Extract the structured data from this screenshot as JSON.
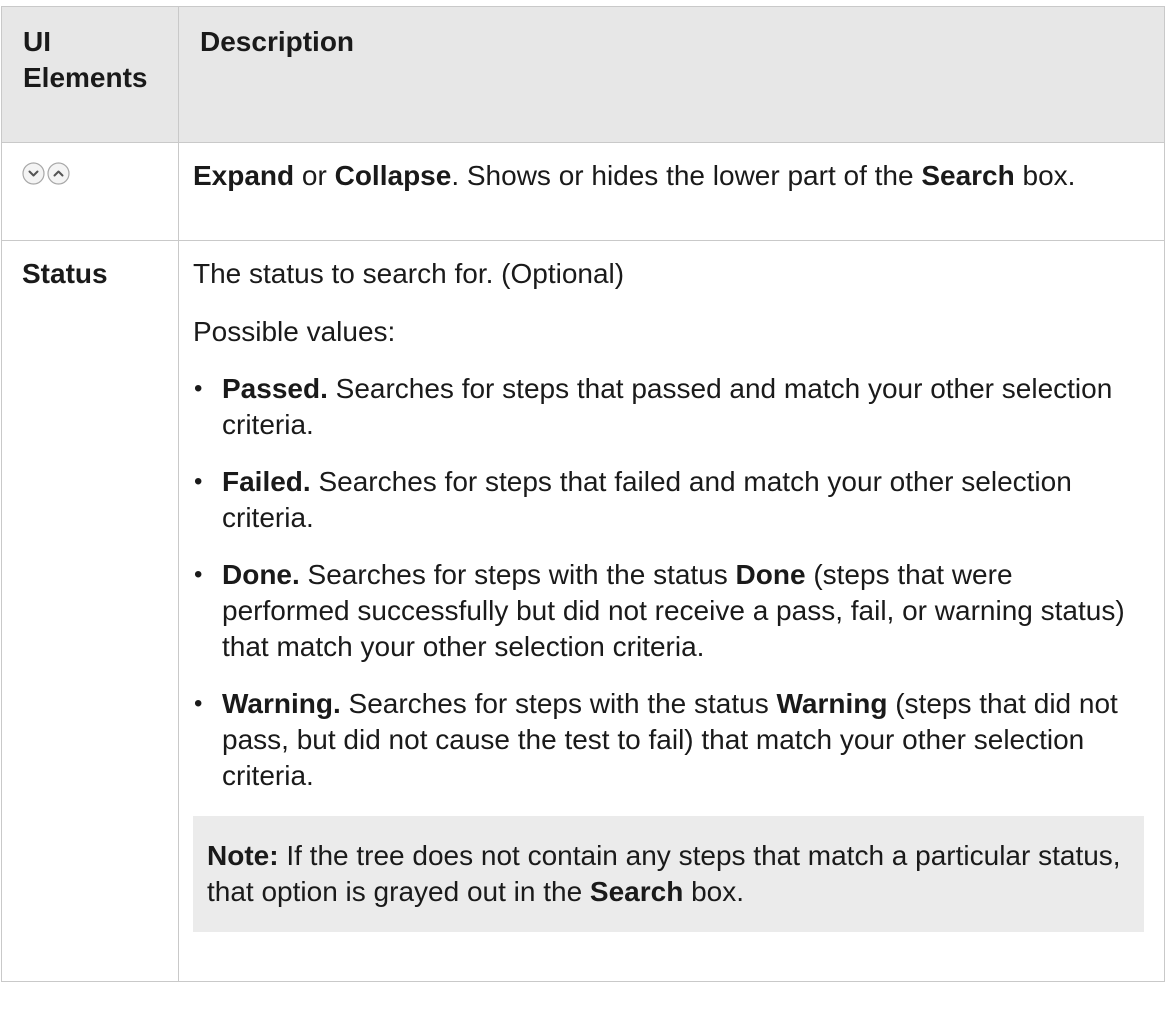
{
  "table": {
    "headers": {
      "col1_line1": "UI",
      "col1_line2": "Elements",
      "col2": "Description"
    },
    "expand_row": {
      "icons": [
        "expand-icon",
        "collapse-icon"
      ],
      "expand": "Expand",
      "or": " or ",
      "collapse": "Collapse",
      "text1": ". Shows or hides the lower part of the ",
      "search": "Search",
      "text2": " box."
    },
    "status_row": {
      "label": "Status",
      "intro": "The status to search for. (Optional)",
      "possible": "Possible values:",
      "bullet": "•",
      "values": [
        {
          "name": "Passed.",
          "text": " Searches for steps that passed and match your other selection criteria."
        },
        {
          "name": "Failed.",
          "text": " Searches for steps that failed and match your other selection criteria."
        },
        {
          "name": "Done.",
          "text_a": " Searches for steps with the status ",
          "bold": "Done",
          "text_b": " (steps that were performed successfully but did not receive a pass, fail, or warning status) that match your other selection criteria."
        },
        {
          "name": "Warning.",
          "text_a": " Searches for steps with the status ",
          "bold": "Warning",
          "text_b": " (steps that did not pass, but did not cause the test to fail) that match your other selection criteria."
        }
      ],
      "note": {
        "label": "Note:",
        "text1": " If the tree does not contain any steps that match a particular status, that option is grayed out in the ",
        "search": "Search",
        "text2": " box."
      }
    }
  }
}
